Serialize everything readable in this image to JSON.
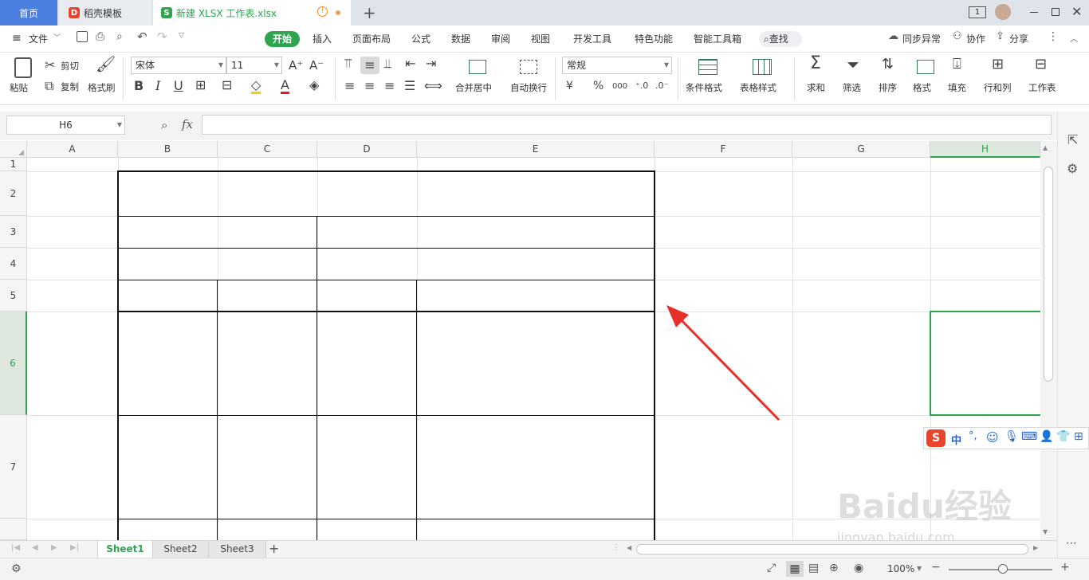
{
  "titlebar": {
    "tab_home": "首页",
    "tab_docer": "稻壳模板",
    "tab_doc": "新建 XLSX 工作表.xlsx",
    "new_tab": "+",
    "window_count": "1"
  },
  "menu": {
    "file": "文件",
    "items": [
      "开始",
      "插入",
      "页面布局",
      "公式",
      "数据",
      "审阅",
      "视图",
      "开发工具",
      "特色功能",
      "智能工具箱"
    ],
    "search": "查找",
    "sync": "同步异常",
    "collab": "协作",
    "share": "分享"
  },
  "ribbon": {
    "paste": "粘贴",
    "cut": "剪切",
    "copy": "复制",
    "format_painter": "格式刷",
    "font_name": "宋体",
    "font_size": "11",
    "merge_center": "合并居中",
    "wrap_text": "自动换行",
    "number_format": "常规",
    "conditional_format": "条件格式",
    "table_style": "表格样式",
    "sum": "求和",
    "filter": "筛选",
    "sort": "排序",
    "format": "格式",
    "fill": "填充",
    "rows_cols": "行和列",
    "worksheet": "工作表",
    "currency": "¥",
    "percent": "%",
    "thousands": "000",
    "fx": "fx"
  },
  "formula": {
    "cell_ref": "H6",
    "value": ""
  },
  "grid": {
    "columns": [
      "A",
      "B",
      "C",
      "D",
      "E",
      "F",
      "G",
      "H"
    ],
    "rows": [
      "1",
      "2",
      "3",
      "4",
      "5",
      "6",
      "7"
    ],
    "selected_cell": "H6"
  },
  "sheets": [
    "Sheet1",
    "Sheet2",
    "Sheet3"
  ],
  "active_sheet": "Sheet1",
  "status": {
    "zoom": "100%"
  },
  "ime": {
    "lang": "中"
  },
  "watermark": {
    "line1": "Baidu经验",
    "line2": "jingyan.baidu.com"
  },
  "colors": {
    "accent_green": "#2ea44f",
    "home_tab_blue": "#4a7fe0",
    "arrow_red": "#e8302a"
  }
}
